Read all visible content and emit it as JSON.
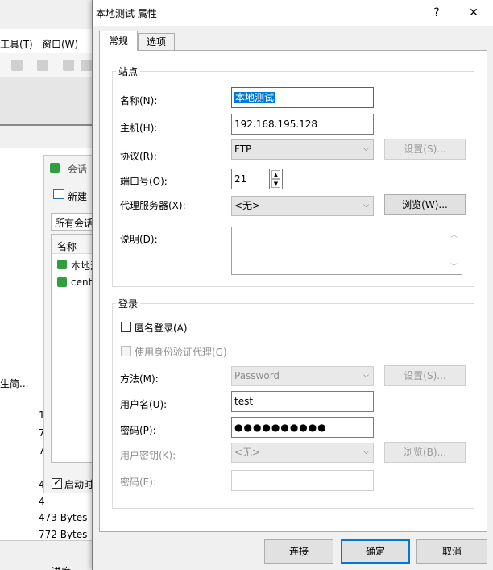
{
  "background_app": {
    "menu": [
      "工具(T)",
      "窗口(W)"
    ],
    "session_panel": {
      "title": "会话",
      "new_label": "新建",
      "all_sessions": "所有会话",
      "col_name": "名称",
      "item1": "本地测",
      "item2": "cento",
      "startup_label": "启动时"
    },
    "left_text": "生简...",
    "numbers": [
      "1",
      "7",
      "7",
      "4",
      "4"
    ],
    "sizes": [
      "473 Bytes",
      "772 Bytes"
    ],
    "bottom": "进度"
  },
  "dialog": {
    "title": "本地测试 属性",
    "help": "?",
    "close": "✕",
    "tabs": [
      "常规",
      "选项"
    ],
    "site": {
      "legend": "站点",
      "name_label": "名称(N):",
      "name_value": "本地测试",
      "host_label": "主机(H):",
      "host_value": "192.168.195.128",
      "protocol_label": "协议(R):",
      "protocol_value": "FTP",
      "settings_btn": "设置(S)...",
      "port_label": "端口号(O):",
      "port_value": "21",
      "proxy_label": "代理服务器(X):",
      "proxy_value": "<无>",
      "browse_btn": "浏览(W)...",
      "desc_label": "说明(D):",
      "desc_value": ""
    },
    "login": {
      "legend": "登录",
      "anon_label": "匿名登录(A)",
      "auth_agent_label": "使用身份验证代理(G)",
      "method_label": "方法(M):",
      "method_value": "Password",
      "settings_btn": "设置(S)...",
      "user_label": "用户名(U):",
      "user_value": "test",
      "pass_label": "密码(P):",
      "pass_value": "●●●●●●●●●●",
      "key_label": "用户密钥(K):",
      "key_value": "<无>",
      "browse_btn": "浏览(B)...",
      "passphrase_label": "密码(E):",
      "passphrase_value": ""
    },
    "buttons": {
      "connect": "连接",
      "ok": "确定",
      "cancel": "取消"
    }
  }
}
